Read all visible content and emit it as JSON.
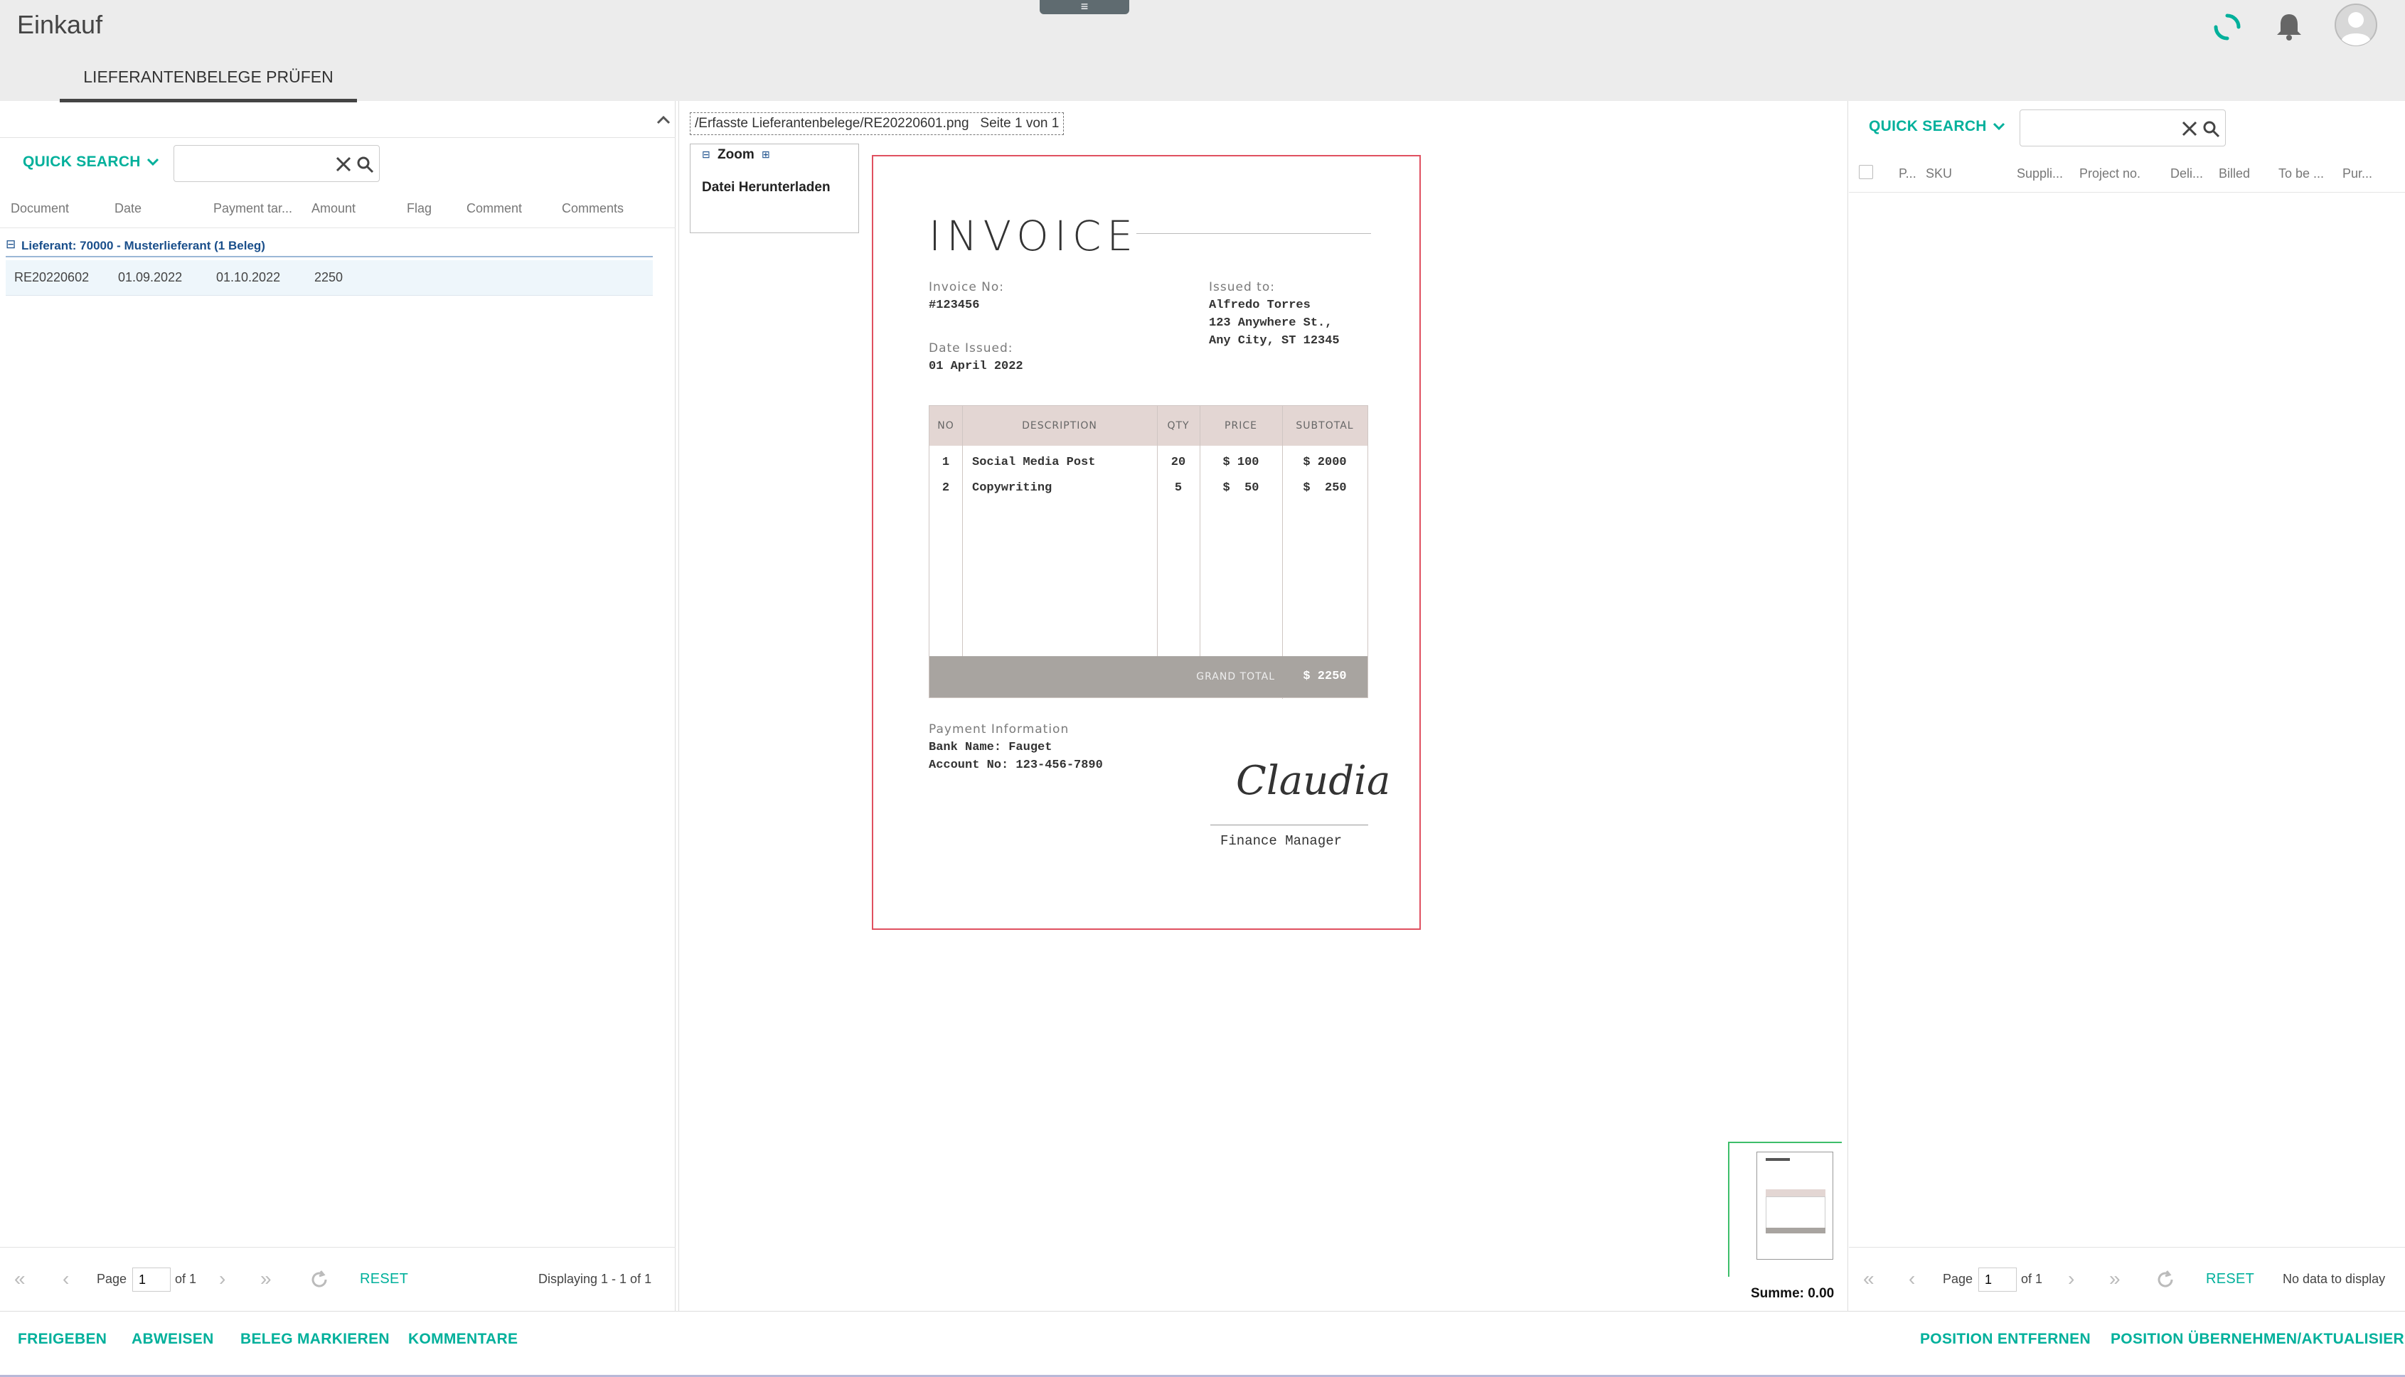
{
  "app": {
    "title": "Einkauf",
    "menu_handle": "≡"
  },
  "header": {
    "tab_label": "LIEFERANTENBELEGE PRÜFEN"
  },
  "left_panel": {
    "quick_search_label": "QUICK SEARCH",
    "search_placeholder": "",
    "columns": [
      "Document",
      "Date",
      "Payment tar...",
      "Amount",
      "Flag",
      "Comment",
      "Comments"
    ],
    "group_toggle": "⊟",
    "group_label": "Lieferant: 70000 - Musterlieferant (1 Beleg)",
    "rows": [
      {
        "document": "RE20220602",
        "date": "01.09.2022",
        "payment_target": "01.10.2022",
        "amount": "2250"
      }
    ],
    "pager": {
      "page_label": "Page",
      "page_value": "1",
      "of_label": "of 1",
      "reset": "RESET",
      "display": "Displaying 1 - 1 of 1"
    }
  },
  "viewer": {
    "path_label": "/Erfasste Lieferantenbelege/RE20220601.png   Seite 1 von 1",
    "zoom_label": "Zoom",
    "download_label": "Datei Herunterladen",
    "sum_label": "Summe: 0.00",
    "invoice": {
      "title": "INVOICE",
      "invoice_no_label": "Invoice No:",
      "invoice_no": "#123456",
      "issued_to_label": "Issued to:",
      "issued_to_lines": [
        "Alfredo Torres",
        "123 Anywhere St.,",
        "Any City, ST 12345"
      ],
      "date_issued_label": "Date Issued:",
      "date_issued": "01 April 2022",
      "table_headers": [
        "NO",
        "DESCRIPTION",
        "QTY",
        "PRICE",
        "SUBTOTAL"
      ],
      "items": [
        {
          "no": "1",
          "description": "Social Media Post",
          "qty": "20",
          "price": "$ 100",
          "subtotal": "$ 2000"
        },
        {
          "no": "2",
          "description": "Copywriting",
          "qty": "5",
          "price": "$  50",
          "subtotal": "$  250"
        }
      ],
      "grand_total_label": "GRAND TOTAL",
      "grand_total": "$ 2250",
      "payment_info_label": "Payment Information",
      "bank_name": "Bank Name: Fauget",
      "account_no": "Account No: 123-456-7890",
      "signature": "Claudia",
      "signer_title": "Finance Manager"
    }
  },
  "right_panel": {
    "quick_search_label": "QUICK SEARCH",
    "columns": [
      "P...",
      "SKU",
      "Suppli...",
      "Project no.",
      "Deli...",
      "Billed",
      "To be ...",
      "Pur..."
    ],
    "pager": {
      "page_label": "Page",
      "page_value": "1",
      "of_label": "of 1",
      "reset": "RESET",
      "display": "No data to display"
    }
  },
  "footer": {
    "left_actions": [
      "FREIGEBEN",
      "ABWEISEN",
      "BELEG MARKIEREN",
      "KOMMENTARE"
    ],
    "right_actions": [
      "POSITION ENTFERNEN",
      "POSITION ÜBERNEHMEN/AKTUALISIEREN"
    ]
  },
  "colors": {
    "accent": "#00b09b",
    "group_blue": "#1a4f8b",
    "invoice_header_bg": "#e3d6d3",
    "grand_total_bg": "#a8a4a0",
    "viewer_border": "#e05060"
  },
  "icons": [
    "menu-handle-icon",
    "loading-spinner-icon",
    "bell-icon",
    "user-avatar-icon",
    "chevron-up-icon",
    "chevron-down-icon",
    "clear-icon",
    "search-icon",
    "first-page-icon",
    "prev-page-icon",
    "next-page-icon",
    "last-page-icon",
    "refresh-icon",
    "collapse-icon",
    "expand-icon"
  ]
}
